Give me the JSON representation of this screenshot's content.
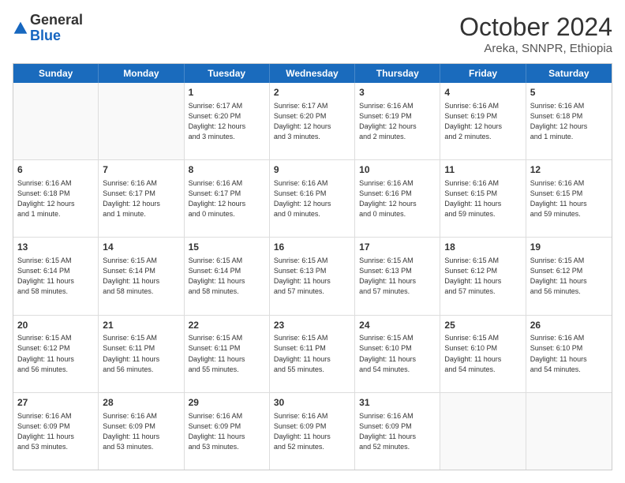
{
  "header": {
    "logo_general": "General",
    "logo_blue": "Blue",
    "month_title": "October 2024",
    "location": "Areka, SNNPR, Ethiopia"
  },
  "weekdays": [
    "Sunday",
    "Monday",
    "Tuesday",
    "Wednesday",
    "Thursday",
    "Friday",
    "Saturday"
  ],
  "rows": [
    [
      {
        "day": "",
        "info": ""
      },
      {
        "day": "",
        "info": ""
      },
      {
        "day": "1",
        "info": "Sunrise: 6:17 AM\nSunset: 6:20 PM\nDaylight: 12 hours\nand 3 minutes."
      },
      {
        "day": "2",
        "info": "Sunrise: 6:17 AM\nSunset: 6:20 PM\nDaylight: 12 hours\nand 3 minutes."
      },
      {
        "day": "3",
        "info": "Sunrise: 6:16 AM\nSunset: 6:19 PM\nDaylight: 12 hours\nand 2 minutes."
      },
      {
        "day": "4",
        "info": "Sunrise: 6:16 AM\nSunset: 6:19 PM\nDaylight: 12 hours\nand 2 minutes."
      },
      {
        "day": "5",
        "info": "Sunrise: 6:16 AM\nSunset: 6:18 PM\nDaylight: 12 hours\nand 1 minute."
      }
    ],
    [
      {
        "day": "6",
        "info": "Sunrise: 6:16 AM\nSunset: 6:18 PM\nDaylight: 12 hours\nand 1 minute."
      },
      {
        "day": "7",
        "info": "Sunrise: 6:16 AM\nSunset: 6:17 PM\nDaylight: 12 hours\nand 1 minute."
      },
      {
        "day": "8",
        "info": "Sunrise: 6:16 AM\nSunset: 6:17 PM\nDaylight: 12 hours\nand 0 minutes."
      },
      {
        "day": "9",
        "info": "Sunrise: 6:16 AM\nSunset: 6:16 PM\nDaylight: 12 hours\nand 0 minutes."
      },
      {
        "day": "10",
        "info": "Sunrise: 6:16 AM\nSunset: 6:16 PM\nDaylight: 12 hours\nand 0 minutes."
      },
      {
        "day": "11",
        "info": "Sunrise: 6:16 AM\nSunset: 6:15 PM\nDaylight: 11 hours\nand 59 minutes."
      },
      {
        "day": "12",
        "info": "Sunrise: 6:16 AM\nSunset: 6:15 PM\nDaylight: 11 hours\nand 59 minutes."
      }
    ],
    [
      {
        "day": "13",
        "info": "Sunrise: 6:15 AM\nSunset: 6:14 PM\nDaylight: 11 hours\nand 58 minutes."
      },
      {
        "day": "14",
        "info": "Sunrise: 6:15 AM\nSunset: 6:14 PM\nDaylight: 11 hours\nand 58 minutes."
      },
      {
        "day": "15",
        "info": "Sunrise: 6:15 AM\nSunset: 6:14 PM\nDaylight: 11 hours\nand 58 minutes."
      },
      {
        "day": "16",
        "info": "Sunrise: 6:15 AM\nSunset: 6:13 PM\nDaylight: 11 hours\nand 57 minutes."
      },
      {
        "day": "17",
        "info": "Sunrise: 6:15 AM\nSunset: 6:13 PM\nDaylight: 11 hours\nand 57 minutes."
      },
      {
        "day": "18",
        "info": "Sunrise: 6:15 AM\nSunset: 6:12 PM\nDaylight: 11 hours\nand 57 minutes."
      },
      {
        "day": "19",
        "info": "Sunrise: 6:15 AM\nSunset: 6:12 PM\nDaylight: 11 hours\nand 56 minutes."
      }
    ],
    [
      {
        "day": "20",
        "info": "Sunrise: 6:15 AM\nSunset: 6:12 PM\nDaylight: 11 hours\nand 56 minutes."
      },
      {
        "day": "21",
        "info": "Sunrise: 6:15 AM\nSunset: 6:11 PM\nDaylight: 11 hours\nand 56 minutes."
      },
      {
        "day": "22",
        "info": "Sunrise: 6:15 AM\nSunset: 6:11 PM\nDaylight: 11 hours\nand 55 minutes."
      },
      {
        "day": "23",
        "info": "Sunrise: 6:15 AM\nSunset: 6:11 PM\nDaylight: 11 hours\nand 55 minutes."
      },
      {
        "day": "24",
        "info": "Sunrise: 6:15 AM\nSunset: 6:10 PM\nDaylight: 11 hours\nand 54 minutes."
      },
      {
        "day": "25",
        "info": "Sunrise: 6:15 AM\nSunset: 6:10 PM\nDaylight: 11 hours\nand 54 minutes."
      },
      {
        "day": "26",
        "info": "Sunrise: 6:16 AM\nSunset: 6:10 PM\nDaylight: 11 hours\nand 54 minutes."
      }
    ],
    [
      {
        "day": "27",
        "info": "Sunrise: 6:16 AM\nSunset: 6:09 PM\nDaylight: 11 hours\nand 53 minutes."
      },
      {
        "day": "28",
        "info": "Sunrise: 6:16 AM\nSunset: 6:09 PM\nDaylight: 11 hours\nand 53 minutes."
      },
      {
        "day": "29",
        "info": "Sunrise: 6:16 AM\nSunset: 6:09 PM\nDaylight: 11 hours\nand 53 minutes."
      },
      {
        "day": "30",
        "info": "Sunrise: 6:16 AM\nSunset: 6:09 PM\nDaylight: 11 hours\nand 52 minutes."
      },
      {
        "day": "31",
        "info": "Sunrise: 6:16 AM\nSunset: 6:09 PM\nDaylight: 11 hours\nand 52 minutes."
      },
      {
        "day": "",
        "info": ""
      },
      {
        "day": "",
        "info": ""
      }
    ]
  ]
}
